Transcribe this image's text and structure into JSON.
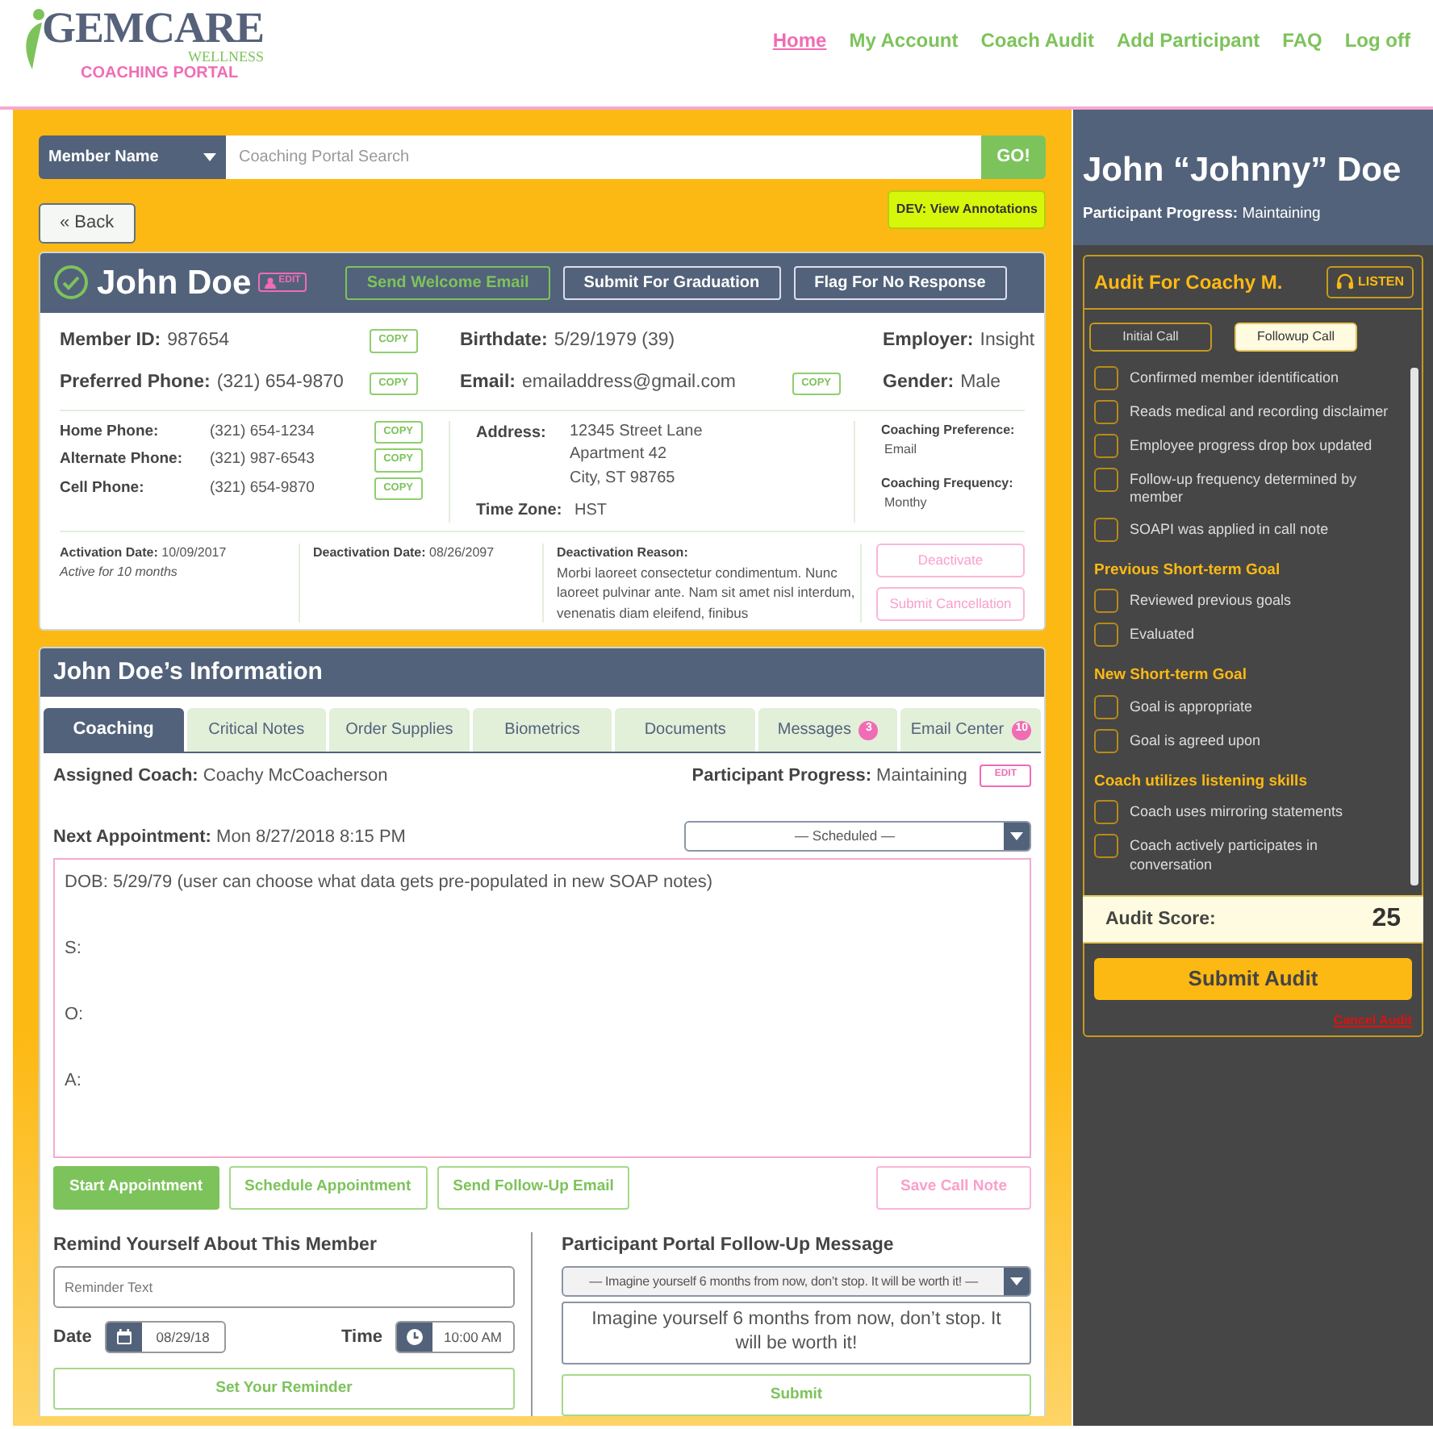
{
  "logo": {
    "brand": "GEMCARE",
    "tagline": "WELLNESS",
    "portal": "COACHING PORTAL"
  },
  "nav": [
    {
      "label": "Home",
      "selected": true
    },
    {
      "label": "My Account",
      "selected": false
    },
    {
      "label": "Coach Audit",
      "selected": false
    },
    {
      "label": "Add Participant",
      "selected": false
    },
    {
      "label": "FAQ",
      "selected": false
    },
    {
      "label": "Log off",
      "selected": false
    }
  ],
  "search": {
    "filter": "Member Name",
    "placeholder": "Coaching Portal Search",
    "button": "GO!"
  },
  "back_button": "« Back",
  "dev_button": "DEV: View Annotations",
  "member": {
    "name": "John Doe",
    "verified": true,
    "edit": "EDIT",
    "actions": [
      {
        "label": "Send Welcome Email",
        "kind": "accent"
      },
      {
        "label": "Submit For Graduation",
        "kind": "plain"
      },
      {
        "label": "Flag For No Response",
        "kind": "plain"
      }
    ],
    "fields": [
      {
        "label": "Member ID:",
        "value": "987654",
        "copy": "COPY"
      },
      {
        "label": "Birthdate:",
        "value": "5/29/1979 (39)"
      },
      {
        "label": "Employer:",
        "value": "Insight"
      },
      {
        "label": "Preferred Phone:",
        "value": "(321) 654-9870",
        "copy": "COPY"
      },
      {
        "label": "Email:",
        "value": "emailaddress@gmail.com",
        "copy": "COPY"
      },
      {
        "label": "Gender:",
        "value": "Male"
      }
    ],
    "phones": [
      {
        "label": "Home Phone:",
        "value": "(321) 654-1234",
        "copy": "COPY"
      },
      {
        "label": "Alternate Phone:",
        "value": "(321) 987-6543",
        "copy": "COPY"
      },
      {
        "label": "Cell Phone:",
        "value": "(321) 654-9870",
        "copy": "COPY"
      }
    ],
    "address": {
      "label": "Address:",
      "lines": [
        "12345 Street Lane",
        "Apartment 42",
        "City, ST 98765"
      ]
    },
    "time_zone": {
      "label": "Time Zone:",
      "value": "HST"
    },
    "coaching": [
      {
        "label": "Coaching Preference:",
        "value": "Email"
      },
      {
        "label": "Coaching Frequency:",
        "value": "Monthy"
      }
    ],
    "activation": {
      "label": "Activation Date:",
      "value": "10/09/2017",
      "note": "Active for 10 months"
    },
    "deactivation": {
      "label": "Deactivation Date:",
      "value": "08/26/2097"
    },
    "reason": {
      "label": "Deactivation Reason:",
      "text": "Morbi laoreet consectetur condimentum. Nunc laoreet pulvinar ante. Nam sit amet nisl interdum, venenatis diam eleifend, finibus"
    },
    "status_actions": [
      "Deactivate",
      "Submit Cancellation"
    ]
  },
  "info": {
    "title": "John Doe’s Information",
    "tabs": [
      {
        "label": "Coaching",
        "selected": true
      },
      {
        "label": "Critical Notes",
        "selected": false
      },
      {
        "label": "Order Supplies",
        "selected": false
      },
      {
        "label": "Biometrics",
        "selected": false
      },
      {
        "label": "Documents",
        "selected": false
      },
      {
        "label": "Messages",
        "badge": "3",
        "selected": false
      },
      {
        "label": "Email Center",
        "badge": "10",
        "selected": false
      }
    ],
    "coach": {
      "label": "Assigned Coach:",
      "value": "Coachy McCoacherson"
    },
    "progress": {
      "label": "Participant Progress:",
      "value": "Maintaining",
      "edit": "EDIT"
    },
    "appointment": {
      "label": "Next Appointment:",
      "value": "Mon 8/27/2018 8:15 PM"
    },
    "status_select": "— Scheduled —",
    "note_lines": [
      "DOB: 5/29/79 (user can choose what data gets pre-populated in new SOAP notes)",
      "S:",
      "O:",
      "A:"
    ],
    "buttons": [
      {
        "label": "Start Appointment",
        "kind": "solid"
      },
      {
        "label": "Schedule Appointment",
        "kind": "outline"
      },
      {
        "label": "Send Follow-Up Email",
        "kind": "outline"
      },
      {
        "label": "Save Call Note",
        "kind": "pink"
      }
    ],
    "reminder": {
      "title": "Remind Yourself About This Member",
      "placeholder": "Reminder Text",
      "date_label": "Date",
      "date": "08/29/18",
      "time_label": "Time",
      "time": "10:00 AM",
      "button": "Set Your Reminder"
    },
    "followup": {
      "title": "Participant Portal Follow-Up Message",
      "select": "— Imagine yourself 6 months from now, don’t stop. It will be worth it! —",
      "message": "Imagine yourself 6 months from now, don’t stop. It will be worth it!",
      "button": "Submit"
    }
  },
  "participant": {
    "name": "John “Johnny” Doe",
    "progress_label": "Participant Progress:",
    "progress": "Maintaining"
  },
  "audit": {
    "title": "Audit For Coachy M.",
    "listen": "LISTEN",
    "call_types": [
      {
        "label": "Initial Call",
        "selected": false
      },
      {
        "label": "Followup Call",
        "selected": true
      }
    ],
    "checklist": [
      {
        "kind": "item",
        "label": "Confirmed member identification",
        "checked": false
      },
      {
        "kind": "item",
        "label": "Reads medical and recording disclaimer",
        "checked": false
      },
      {
        "kind": "item",
        "label": "Employee progress drop box updated",
        "checked": false
      },
      {
        "kind": "item",
        "label": "Follow-up frequency determined by member",
        "checked": false
      },
      {
        "kind": "item",
        "label": "SOAPI was applied in call note",
        "checked": false
      },
      {
        "kind": "heading",
        "label": "Previous Short-term Goal"
      },
      {
        "kind": "item",
        "label": "Reviewed previous goals",
        "checked": false
      },
      {
        "kind": "item",
        "label": "Evaluated",
        "checked": false
      },
      {
        "kind": "heading",
        "label": "New Short-term Goal"
      },
      {
        "kind": "item",
        "label": "Goal is appropriate",
        "checked": false
      },
      {
        "kind": "item",
        "label": "Goal is agreed upon",
        "checked": false
      },
      {
        "kind": "heading",
        "label": "Coach utilizes listening skills"
      },
      {
        "kind": "item",
        "label": "Coach uses mirroring statements",
        "checked": false
      },
      {
        "kind": "item",
        "label": "Coach actively participates in conversation",
        "checked": false
      }
    ],
    "score_label": "Audit Score:",
    "score": "25",
    "submit": "Submit Audit",
    "cancel": "Cancel Audit"
  }
}
